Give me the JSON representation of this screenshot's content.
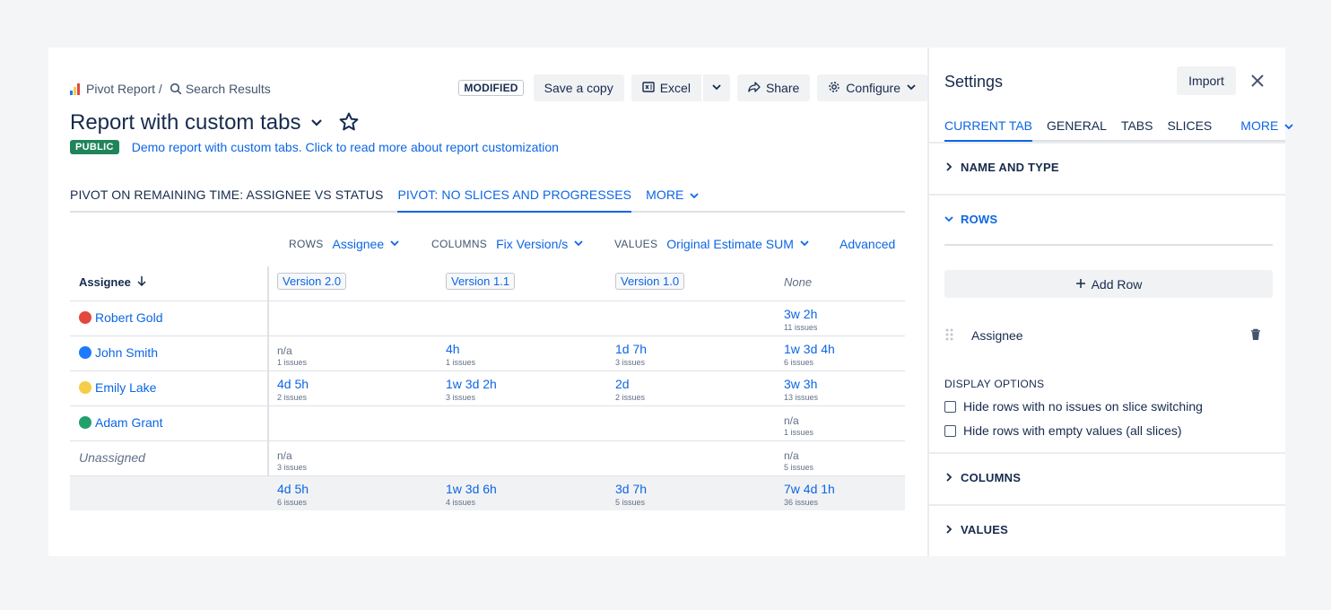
{
  "breadcrumb": {
    "app": "Pivot Report /",
    "page": "Search Results"
  },
  "toolbar": {
    "status": "MODIFIED",
    "save_copy": "Save a copy",
    "excel": "Excel",
    "share": "Share",
    "configure": "Configure"
  },
  "report": {
    "title": "Report with custom tabs",
    "visibility": "PUBLIC",
    "description": "Demo report with custom tabs. Click to read more about report customization"
  },
  "tabs": [
    {
      "label": "PIVOT ON REMAINING TIME: ASSIGNEE VS STATUS",
      "active": false
    },
    {
      "label": "PIVOT: NO SLICES AND PROGRESSES",
      "active": true
    }
  ],
  "tabs_more": "MORE",
  "axes": {
    "rows_label": "ROWS",
    "rows_value": "Assignee",
    "columns_label": "COLUMNS",
    "columns_value": "Fix Version/s",
    "values_label": "VALUES",
    "values_value": "Original Estimate SUM",
    "advanced": "Advanced"
  },
  "table": {
    "header": "Assignee",
    "columns": [
      "Version 2.0",
      "Version 1.1",
      "Version 1.0",
      "None"
    ],
    "rows": [
      {
        "name": "Robert Gold",
        "avatar": "#e2483d",
        "cells": [
          null,
          null,
          null,
          {
            "v": "3w 2h",
            "s": "11 issues"
          }
        ]
      },
      {
        "name": "John Smith",
        "avatar": "#1d7afc",
        "cells": [
          {
            "v": "n/a",
            "s": "1 issues"
          },
          {
            "v": "4h",
            "s": "1 issues"
          },
          {
            "v": "1d 7h",
            "s": "3 issues"
          },
          {
            "v": "1w 3d 4h",
            "s": "6 issues"
          }
        ]
      },
      {
        "name": "Emily Lake",
        "avatar": "#f5cd47",
        "cells": [
          {
            "v": "4d 5h",
            "s": "2 issues"
          },
          {
            "v": "1w 3d 2h",
            "s": "3 issues"
          },
          {
            "v": "2d",
            "s": "2 issues"
          },
          {
            "v": "3w 3h",
            "s": "13 issues"
          }
        ]
      },
      {
        "name": "Adam Grant",
        "avatar": "#22a06b",
        "cells": [
          null,
          null,
          null,
          {
            "v": "n/a",
            "s": "1 issues"
          }
        ]
      },
      {
        "name": "Unassigned",
        "avatar": null,
        "cells": [
          {
            "v": "n/a",
            "s": "3 issues"
          },
          null,
          null,
          {
            "v": "n/a",
            "s": "5 issues"
          }
        ]
      }
    ],
    "totals": [
      {
        "v": "4d 5h",
        "s": "6 issues"
      },
      {
        "v": "1w 3d 6h",
        "s": "4 issues"
      },
      {
        "v": "3d 7h",
        "s": "5 issues"
      },
      {
        "v": "7w 4d 1h",
        "s": "36 issues"
      }
    ]
  },
  "settings": {
    "title": "Settings",
    "import": "Import",
    "tabs": [
      "CURRENT TAB",
      "GENERAL",
      "TABS",
      "SLICES"
    ],
    "more": "MORE",
    "sections": {
      "name_type": "NAME AND TYPE",
      "rows": "ROWS",
      "columns": "COLUMNS",
      "values": "VALUES"
    },
    "add_row": "Add Row",
    "row_field": "Assignee",
    "display_options": "DISPLAY OPTIONS",
    "opt1": "Hide rows with no issues on slice switching",
    "opt2": "Hide rows with empty values (all slices)"
  },
  "colors": {
    "link": "#0c66e4",
    "public": "#1f845a"
  }
}
